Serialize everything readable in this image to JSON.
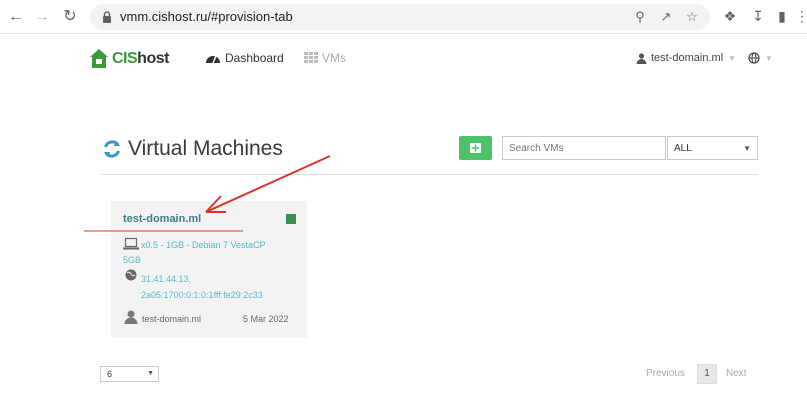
{
  "browser": {
    "url": "vmm.cishost.ru/#provision-tab",
    "back_icon": "arrow-left-icon",
    "forward_icon": "arrow-right-icon",
    "reload_icon": "reload-icon"
  },
  "nav": {
    "logo_prefix": "CIS",
    "logo_suffix": "host",
    "items": [
      {
        "label": "Dashboard",
        "icon": "dashboard-icon",
        "active": true
      },
      {
        "label": "VMs",
        "icon": "grid-icon",
        "active": false
      }
    ],
    "user": "test-domain.ml"
  },
  "page": {
    "title": "Virtual Machines",
    "search_placeholder": "Search VMs",
    "filter_value": "ALL"
  },
  "vms": [
    {
      "name": "test-domain.ml",
      "spec_line1": "x0.5 - 1GB - Debian 7 VestaCP",
      "spec_line2": "5GB",
      "ip_line1": "31.41.44.13,",
      "ip_line2": "2a05:1700:0:1:0:1fff:fe29:2c33",
      "owner": "test-domain.ml",
      "date": "5 Mar 2022",
      "status_color": "#3d8c50"
    }
  ],
  "pagination": {
    "per_page": "6",
    "previous": "Previous",
    "current": "1",
    "next": "Next"
  },
  "colors": {
    "accent_green": "#4cc26b",
    "link_teal": "#3f7c8e",
    "annotation_red": "#d9342b"
  }
}
